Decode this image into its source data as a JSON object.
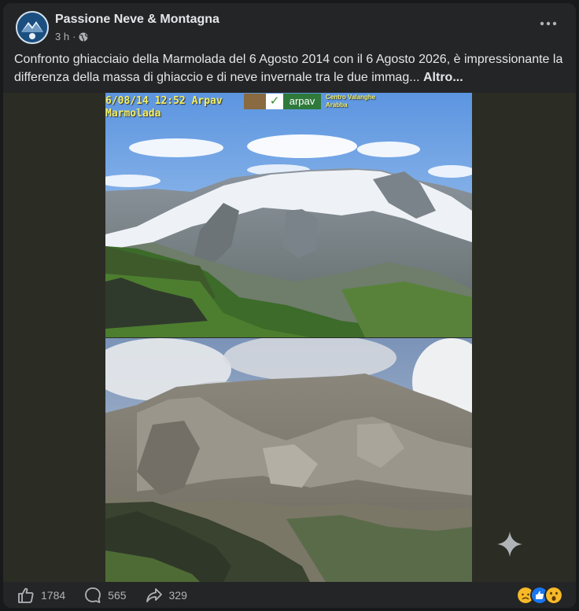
{
  "post": {
    "page_name": "Passione Neve & Montagna",
    "time": "3 h",
    "dot": "·",
    "text": "Confronto ghiacciaio della Marmolada del 6 Agosto 2014 con il 6 Agosto 2026, è impressionante la differenza della massa di ghiaccio e di neve invernale tra le due immag...",
    "more_label": "Altro..."
  },
  "photo_top": {
    "date_line": "6/08/14 12:52 Arpav",
    "place_line": "Marmolada",
    "logo_text": "arpav",
    "center_line1": "Centro Valanghe",
    "center_line2": "Arabba"
  },
  "stats": {
    "likes": "1784",
    "comments": "565",
    "shares": "329"
  },
  "icons": {
    "like": "thumbs-up-icon",
    "comment": "comment-bubble-icon",
    "share": "share-arrow-icon",
    "more": "more-dots-icon",
    "globe": "globe-icon",
    "sparkle": "sparkle-icon"
  },
  "colors": {
    "card_bg": "#242526",
    "page_bg": "#18191a",
    "text": "#e4e6eb",
    "muted": "#b0b3b8",
    "overlay_yellow": "#f2ee62"
  }
}
